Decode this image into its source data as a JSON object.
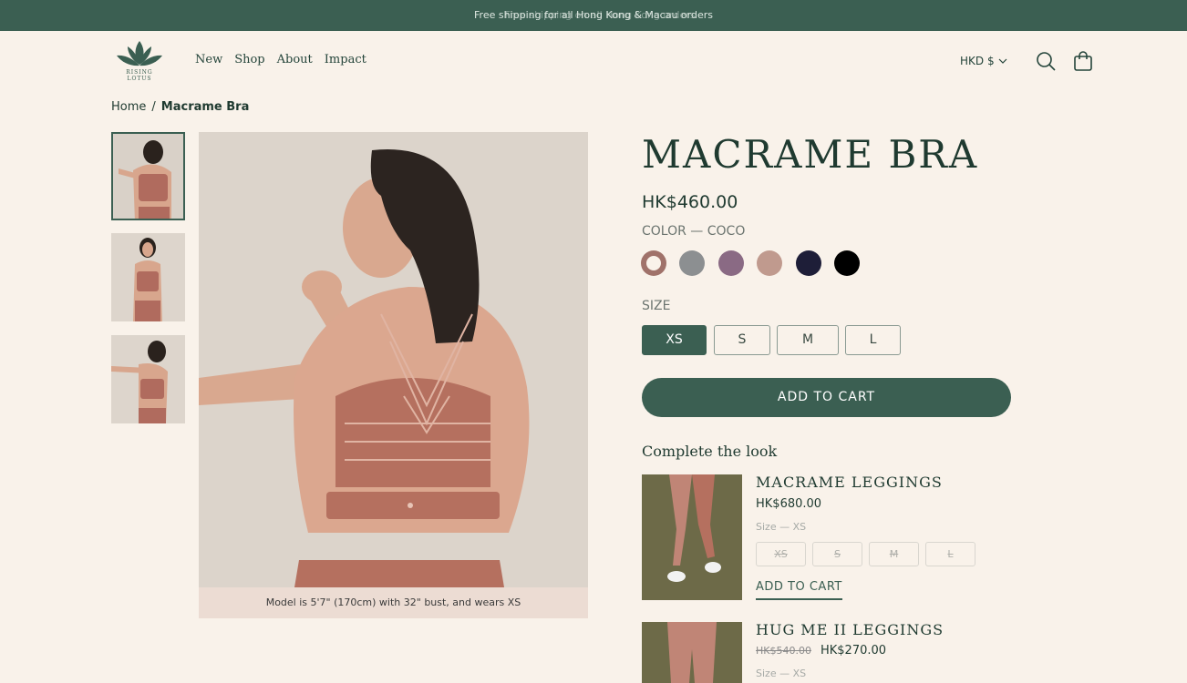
{
  "announcement": {
    "text": "Free shipping for all Hong Kong & Macau orders",
    "ghost_text": "Free shipping on all Hong Kong orders"
  },
  "brand": {
    "logo_text": "RISING LOTUS"
  },
  "nav": {
    "items": [
      "New",
      "Shop",
      "About",
      "Impact"
    ]
  },
  "header": {
    "currency": "HKD $",
    "search_icon": "search-icon",
    "bag_icon": "shopping-bag-icon"
  },
  "breadcrumb": {
    "home": "Home",
    "separator": "/",
    "current": "Macrame Bra"
  },
  "gallery": {
    "caption": "Model is 5'7\" (170cm) with 32\" bust, and wears XS"
  },
  "product": {
    "title": "MACRAME BRA",
    "price": "HK$460.00",
    "color_label": "COLOR — COCO",
    "colors": [
      "#a0726a",
      "#8c8f91",
      "#8a6a84",
      "#c09a8e",
      "#1e1e38",
      "#000000"
    ],
    "selected_color": 0,
    "size_label": "SIZE",
    "sizes": [
      "XS",
      "S",
      "M",
      "L"
    ],
    "selected_size": "XS",
    "add_to_cart": "ADD TO CART"
  },
  "complete_the_look": {
    "title": "Complete the look",
    "items": [
      {
        "name": "MACRAME LEGGINGS",
        "price": "HK$680.00",
        "size_label": "Size — XS",
        "sizes": [
          "XS",
          "S",
          "M",
          "L"
        ],
        "sizes_available": false,
        "add_to_cart": "ADD TO CART"
      },
      {
        "name": "HUG ME II LEGGINGS",
        "old_price": "HK$540.00",
        "price": "HK$270.00",
        "size_label": "Size — XS"
      }
    ]
  },
  "colors": {
    "accent": "#3b5f52",
    "background": "#f9f2ea",
    "caption_bg": "#ecdcd3"
  }
}
